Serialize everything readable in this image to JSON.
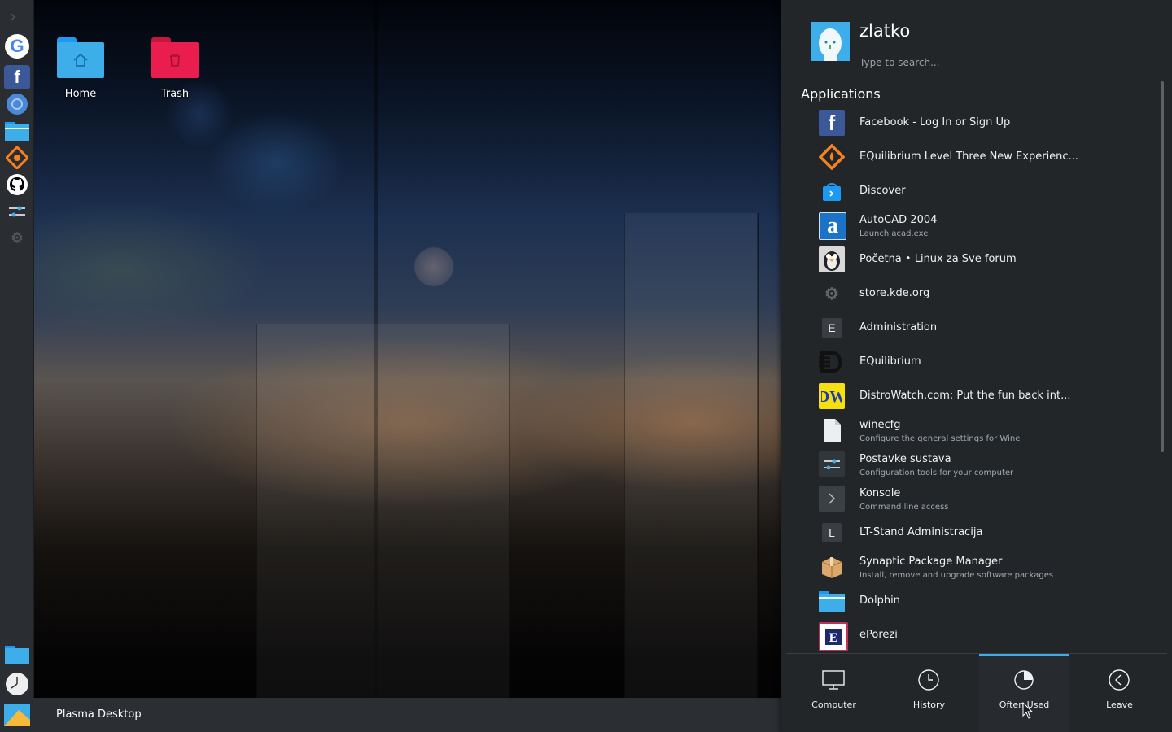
{
  "desktop": {
    "icons": [
      {
        "label": "Home"
      },
      {
        "label": "Trash"
      }
    ]
  },
  "taskbar": {
    "task_label": "Plasma Desktop"
  },
  "dock": {
    "top_icons": [
      "google-icon",
      "facebook-icon",
      "chromium-icon",
      "folder-icon",
      "equilibrium-icon",
      "github-icon",
      "settings-icon",
      "kde-store-icon"
    ],
    "bottom_icons": [
      "dolphin-icon",
      "clock-icon",
      "desktop-icon"
    ]
  },
  "launcher": {
    "username": "zlatko",
    "search_placeholder": "Type to search...",
    "section_title": "Applications",
    "apps": [
      {
        "name": "Facebook - Log In or Sign Up",
        "desc": ""
      },
      {
        "name": "EQuilibrium Level Three New Experienc...",
        "desc": ""
      },
      {
        "name": "Discover",
        "desc": ""
      },
      {
        "name": "AutoCAD 2004",
        "desc": "Launch acad.exe"
      },
      {
        "name": "Početna • Linux za Sve forum",
        "desc": ""
      },
      {
        "name": "store.kde.org",
        "desc": ""
      },
      {
        "name": "Administration",
        "desc": "",
        "letter": "E"
      },
      {
        "name": "EQuilibrium",
        "desc": ""
      },
      {
        "name": "DistroWatch.com: Put the fun back int...",
        "desc": ""
      },
      {
        "name": "winecfg",
        "desc": "Configure the general settings for Wine"
      },
      {
        "name": "Postavke sustava",
        "desc": "Configuration tools for your computer"
      },
      {
        "name": "Konsole",
        "desc": "Command line access"
      },
      {
        "name": "LT-Stand Administracija",
        "desc": "",
        "letter": "L"
      },
      {
        "name": "Synaptic Package Manager",
        "desc": "Install, remove and upgrade software packages"
      },
      {
        "name": "Dolphin",
        "desc": ""
      },
      {
        "name": "ePorezi",
        "desc": ""
      }
    ],
    "tabs": [
      {
        "label": "Computer"
      },
      {
        "label": "History"
      },
      {
        "label": "Often Used"
      },
      {
        "label": "Leave"
      }
    ],
    "active_tab": "Often Used"
  },
  "colors": {
    "accent": "#3daee9",
    "panel_bg": "#232629",
    "dock_bg": "#2a2e32"
  }
}
